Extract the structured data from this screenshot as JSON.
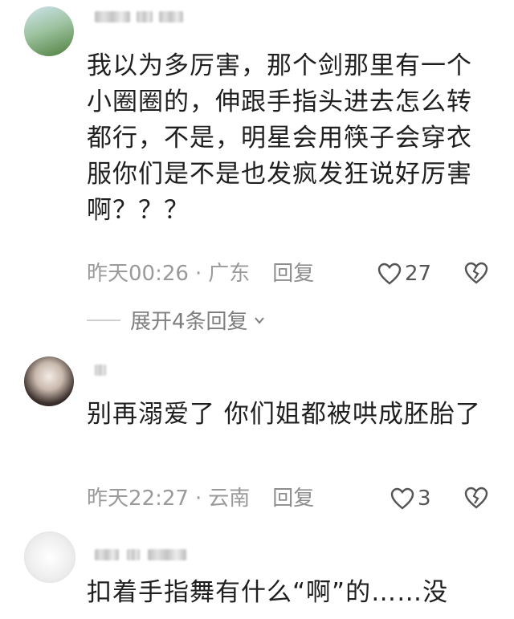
{
  "comments": [
    {
      "text": "我以为多厉害，那个剑那里有一个小圈圈的，伸跟手指头进去怎么转都行，不是，明星会用筷子会穿衣服你们是不是也发疯发狂说好厉害啊？？？",
      "time": "昨天00:26",
      "sep": "·",
      "location": "广东",
      "reply_label": "回复",
      "likes": "27"
    },
    {
      "text": "别再溺爱了 你们姐都被哄成胚胎了",
      "time": "昨天22:27",
      "sep": "·",
      "location": "云南",
      "reply_label": "回复",
      "likes": "3"
    },
    {
      "text": "扣着手指舞有什么“啊”的……没"
    }
  ],
  "expand_replies_label": "展开4条回复",
  "icons": {
    "like": "heart-outline-icon",
    "dislike": "broken-heart-icon",
    "expand": "chevron-down-icon"
  },
  "colors": {
    "text": "#1f1f1f",
    "meta": "#9a9a9a"
  }
}
